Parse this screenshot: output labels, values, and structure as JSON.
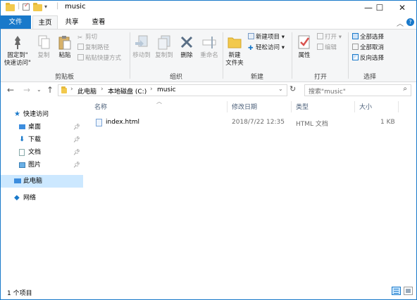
{
  "window": {
    "title": "music",
    "minimize": "—",
    "maximize": "☐",
    "close": "✕"
  },
  "ribbon_tabs": [
    "文件",
    "主页",
    "共享",
    "查看"
  ],
  "ribbon": {
    "clipboard": {
      "group_label": "剪贴板",
      "pin_quick_access": [
        "固定到\"",
        "快速访问\""
      ],
      "copy": "复制",
      "paste": "粘贴",
      "cut": "剪切",
      "copy_path": "复制路径",
      "paste_shortcut": "粘贴快捷方式"
    },
    "organize": {
      "group_label": "组织",
      "move_to": "移动到",
      "copy_to": "复制到",
      "delete": "删除",
      "rename": "重命名"
    },
    "new": {
      "group_label": "新建",
      "new_folder": [
        "新建",
        "文件夹"
      ],
      "new_item": "新建项目",
      "easy_access": "轻松访问"
    },
    "open": {
      "group_label": "打开",
      "properties": "属性",
      "open": "打开",
      "edit": "编辑"
    },
    "select": {
      "group_label": "选择",
      "select_all": "全部选择",
      "select_none": "全部取消",
      "invert_selection": "反向选择"
    }
  },
  "address": {
    "breadcrumbs": [
      "此电脑",
      "本地磁盘 (C:)",
      "music"
    ],
    "search_placeholder": "搜索\"music\""
  },
  "nav_pane": {
    "quick_access": "快速访问",
    "pinned": [
      "桌面",
      "下载",
      "文档",
      "图片"
    ],
    "this_pc": "此电脑",
    "network": "网络"
  },
  "columns": [
    "名称",
    "修改日期",
    "类型",
    "大小"
  ],
  "files": [
    {
      "name": "index.html",
      "modified": "2018/7/22 12:35",
      "type": "HTML 文档",
      "size": "1 KB"
    }
  ],
  "status": {
    "item_count": "1 个项目"
  },
  "colors": {
    "accent": "#1979ca",
    "selection": "#cce8ff",
    "folder": "#f2c94c"
  }
}
